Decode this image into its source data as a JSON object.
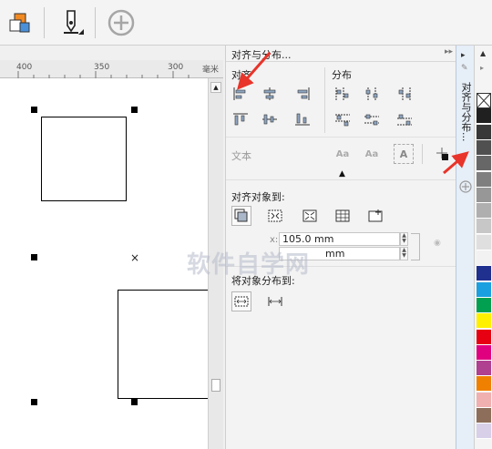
{
  "toolbar": {
    "tools": [
      "align-shapes-icon",
      "pen-tool-icon",
      "add-icon"
    ]
  },
  "ruler": {
    "ticks": [
      "400",
      "350",
      "300"
    ],
    "unit": "毫米"
  },
  "docker": {
    "title": "对齐与分布...",
    "align_label": "对齐",
    "distribute_label": "分布",
    "text_label": "文本",
    "align_to_label": "对齐对象到:",
    "x_value": "105.0 mm",
    "y_value": "mm",
    "distribute_to_label": "将对象分布到:"
  },
  "tabstrip": {
    "label": "对齐与分布..."
  },
  "palette": {
    "colors": [
      "#ffffff",
      "#202020",
      "#383838",
      "#505050",
      "#676767",
      "#7f7f7f",
      "#979797",
      "#afafaf",
      "#c7c7c7",
      "#dfdfdf",
      "#f2f2f2",
      "#20308f",
      "#1aa0e0",
      "#00a050",
      "#fff000",
      "#e60012",
      "#e0007f",
      "#b04090",
      "#f08000",
      "#f0b0b0",
      "#8c6e5a",
      "#d8d0e8"
    ]
  },
  "watermark": "软件自学网",
  "annotations": {
    "arrow_color": "#e8342a"
  }
}
